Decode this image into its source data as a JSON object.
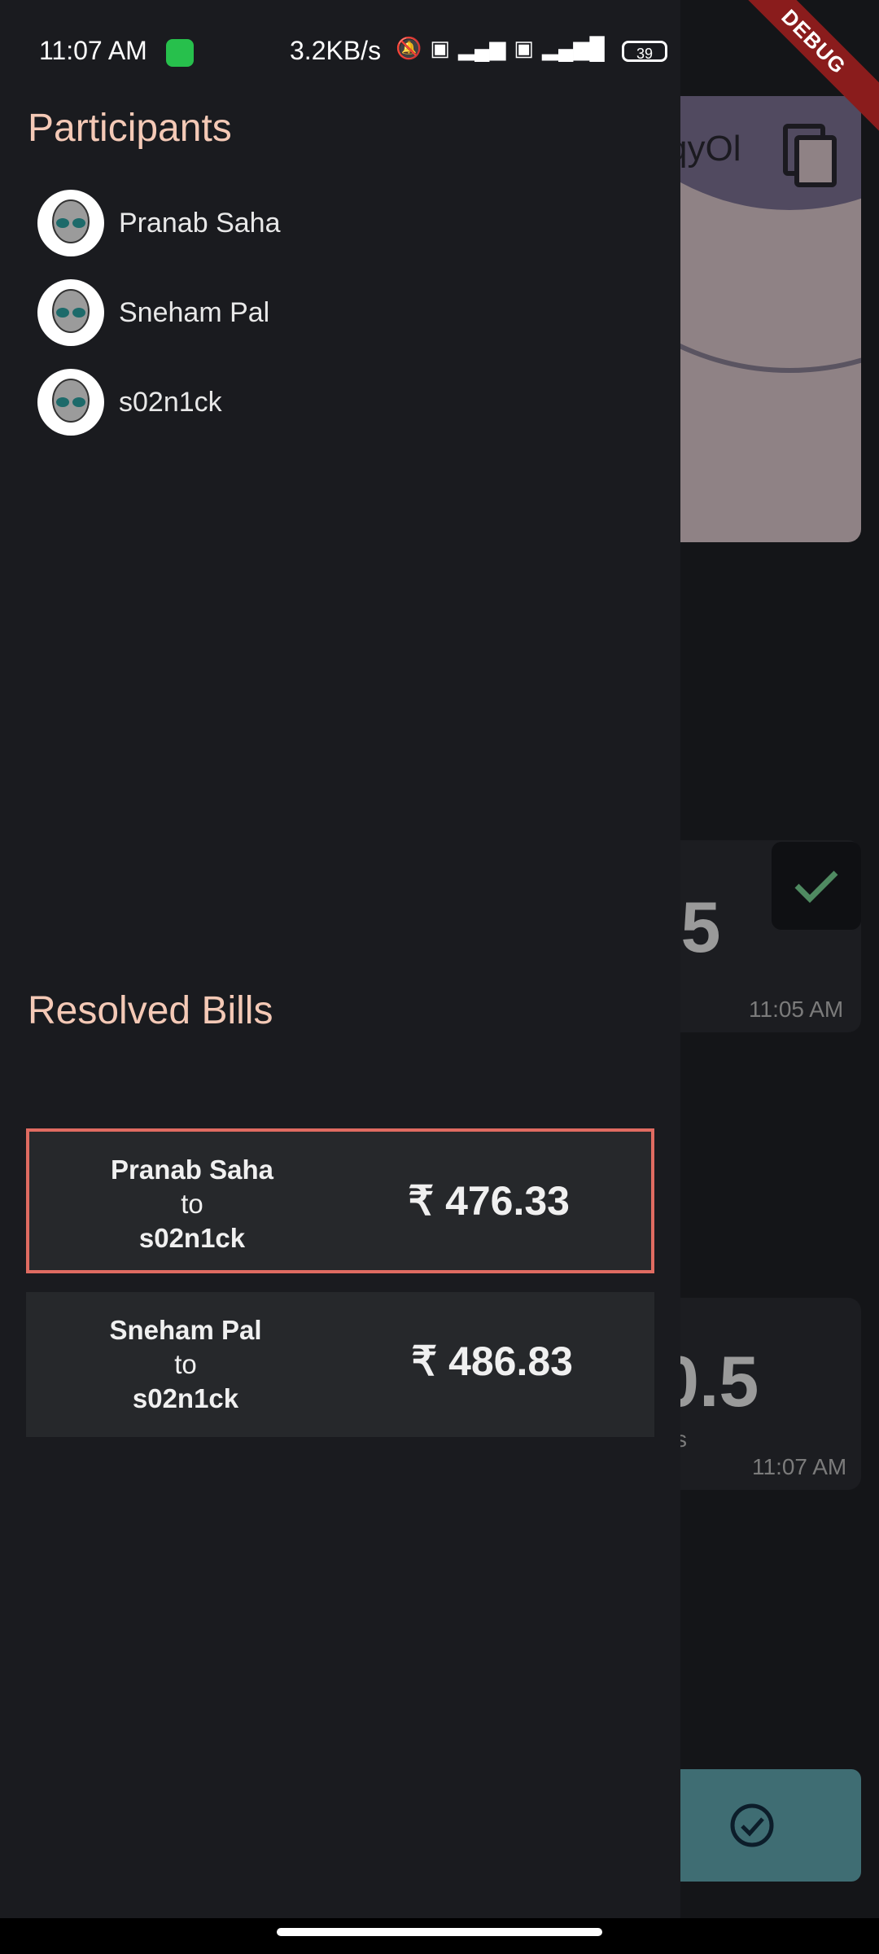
{
  "status_bar": {
    "time": "11:07 AM",
    "net_speed": "3.2KB/s",
    "battery": "39",
    "icons": [
      "whatsapp-icon",
      "mute-icon",
      "volte-icon",
      "signal-4g-icon",
      "volte-icon",
      "signal-icon",
      "battery-icon"
    ]
  },
  "debug_banner": "DEBUG",
  "background": {
    "code_fragment": "qyOl",
    "values": [
      ".5",
      "0.5"
    ],
    "times": [
      "11:05 AM",
      "11:07 AM"
    ],
    "small_fragment": "s"
  },
  "drawer": {
    "participants_title": "Participants",
    "participants": [
      "Pranab Saha",
      "Sneham Pal",
      "s02n1ck"
    ],
    "resolved_title": "Resolved Bills",
    "bills": [
      {
        "from": "Pranab Saha",
        "to_word": "to",
        "to": "s02n1ck",
        "amount": "₹ 476.33",
        "selected": true
      },
      {
        "from": "Sneham Pal",
        "to_word": "to",
        "to": "s02n1ck",
        "amount": "₹ 486.83",
        "selected": false
      }
    ]
  },
  "colors": {
    "title": "#f4c9b6",
    "drawer_bg": "#1a1b1f",
    "bill_bg": "#26282b",
    "selected_border": "#e06b61",
    "fab": "#3f6d73"
  }
}
